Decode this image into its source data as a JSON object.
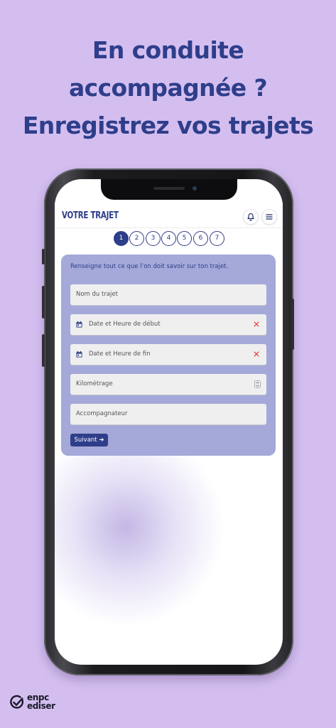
{
  "headline": {
    "line1": "En conduite",
    "line2": "accompagnée ?",
    "line3": "Enregistrez vos trajets"
  },
  "app": {
    "title": "VOTRE TRAJET",
    "icons": [
      "bell-icon",
      "menu-icon"
    ]
  },
  "stepper": {
    "steps": [
      "1",
      "2",
      "3",
      "4",
      "5",
      "6",
      "7"
    ],
    "active_step": "1"
  },
  "form": {
    "intro": "Renseigne tout ce que l’on doit savoir sur ton trajet.",
    "trip_name_placeholder": "Nom du trajet",
    "start_placeholder": "Date et Heure de début",
    "end_placeholder": "Date et Heure de fin",
    "mileage_placeholder": "Kilomètrage",
    "companion_placeholder": "Accompagnateur",
    "next_label": "Suivant ➜"
  },
  "brand": {
    "line1": "enpc",
    "line2": "ediser"
  },
  "colors": {
    "background": "#d4bef0",
    "primary": "#2e3e8a",
    "card": "#a4a9d9",
    "clear": "#e53935"
  }
}
